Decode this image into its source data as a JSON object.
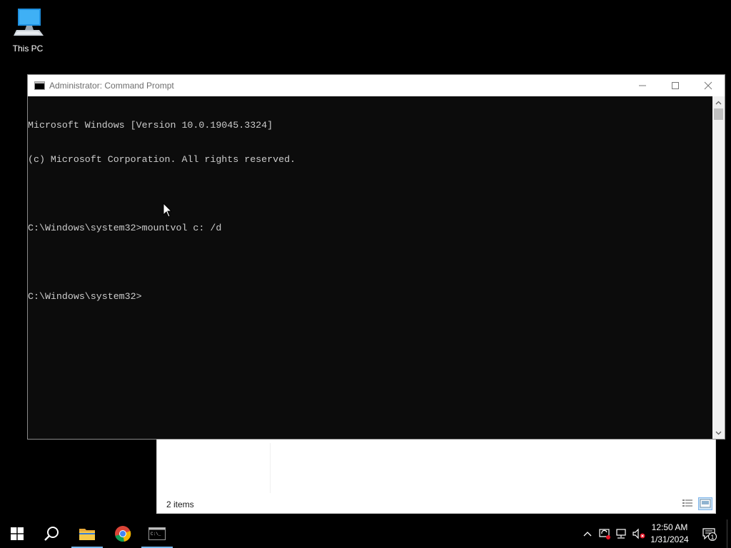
{
  "desktop": {
    "icons": [
      {
        "label": "This PC",
        "icon": "this-pc-icon"
      }
    ]
  },
  "explorer": {
    "status_text": "2 items"
  },
  "cmd": {
    "title": "Administrator: Command Prompt",
    "lines": [
      "Microsoft Windows [Version 10.0.19045.3324]",
      "(c) Microsoft Corporation. All rights reserved.",
      "",
      "C:\\Windows\\system32>mountvol c: /d",
      "",
      "C:\\Windows\\system32>"
    ]
  },
  "taskbar": {
    "buttons": [
      {
        "name": "start",
        "icon": "windows-logo-icon"
      },
      {
        "name": "search",
        "icon": "search-icon"
      },
      {
        "name": "file-explorer",
        "icon": "folder-icon"
      },
      {
        "name": "chrome",
        "icon": "chrome-icon"
      },
      {
        "name": "command-prompt",
        "icon": "terminal-icon"
      }
    ],
    "tray_icons": [
      "chevron-up-icon",
      "network-sync-icon",
      "network-icon",
      "volume-muted-icon"
    ],
    "time": "12:50 AM",
    "date": "1/31/2024",
    "notification_count": "1"
  },
  "colors": {
    "console_bg": "#0c0c0c",
    "console_text": "#cccccc",
    "accent": "#76b9ed"
  }
}
